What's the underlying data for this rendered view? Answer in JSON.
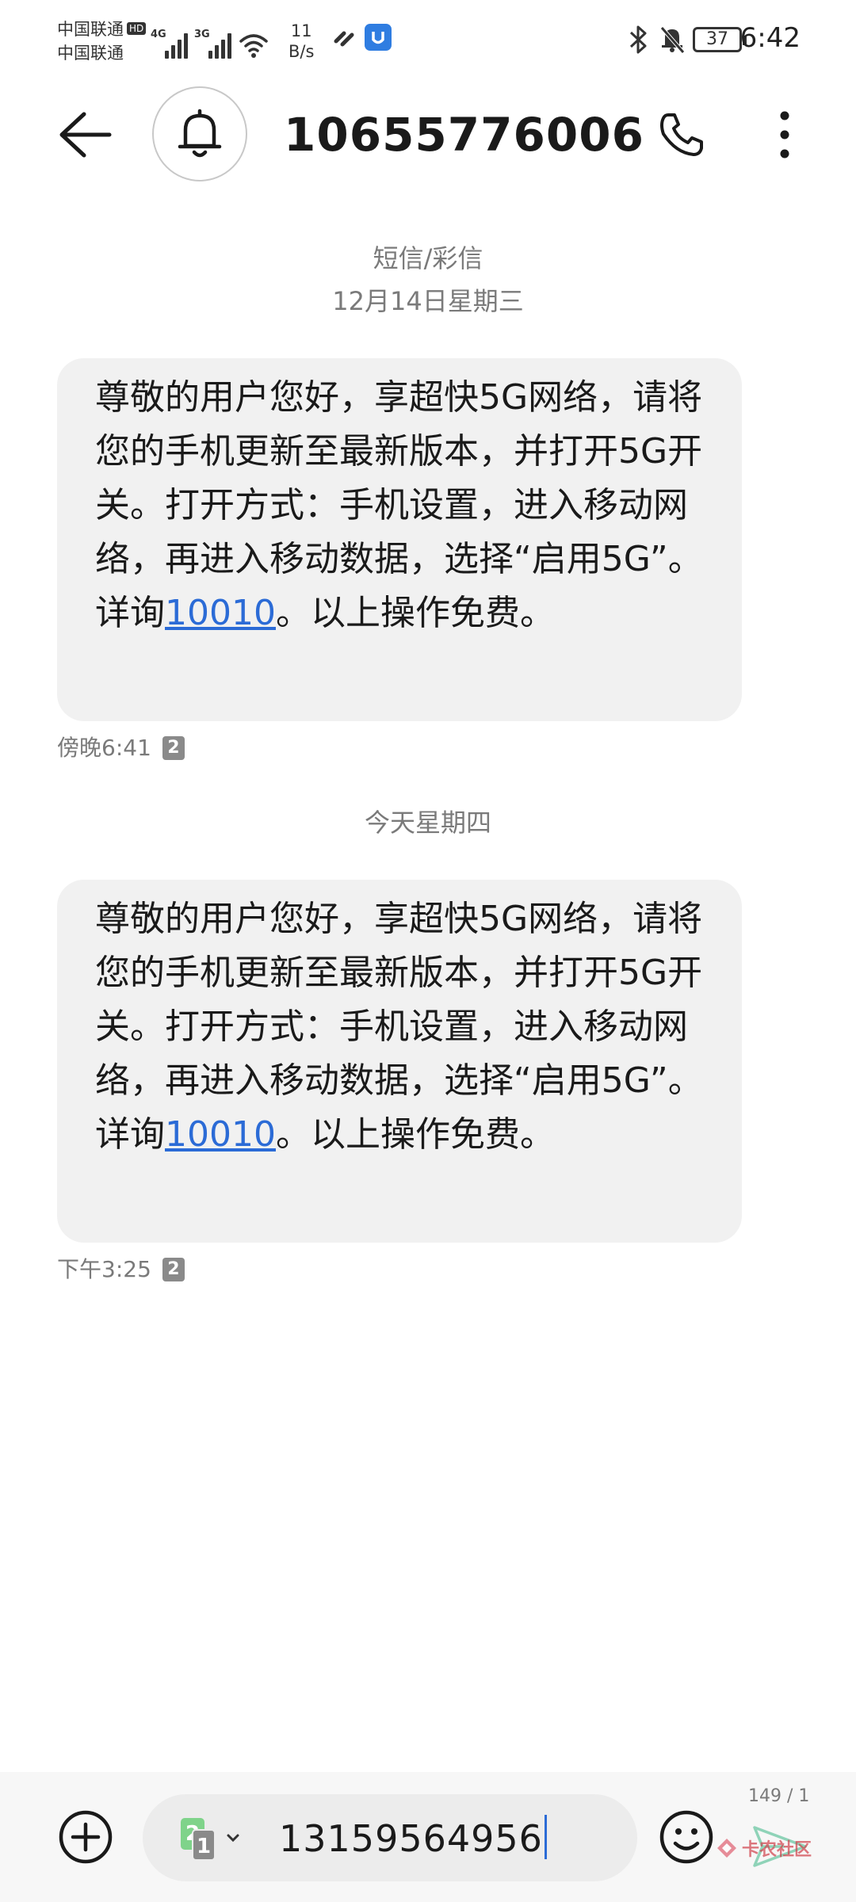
{
  "status_bar": {
    "carrier_1": "中国联通",
    "carrier_1_badge": "HD",
    "carrier_2": "中国联通",
    "signal_1_label": "4G",
    "signal_2_label": "3G",
    "net_speed_value": "11",
    "net_speed_unit": "B/s",
    "battery": "37",
    "time": "6:42"
  },
  "header": {
    "title": "10655776006"
  },
  "conversation": {
    "sep_1_type": "短信/彩信",
    "sep_1_date": "12月14日星期三",
    "msg_1": {
      "text_before": "尊敬的用户您好，享超快5G网络，请将您的手机更新至最新版本，并打开5G开关。打开方式：手机设置，进入移动网络，再进入移动数据，选择“启用5G”。详询",
      "link": "10010",
      "text_after": "。以上操作免费。",
      "time": "傍晚6:41",
      "sim": "2"
    },
    "sep_2_date": "今天星期四",
    "msg_2": {
      "text_before": "尊敬的用户您好，享超快5G网络，请将您的手机更新至最新版本，并打开5G开关。打开方式：手机设置，进入移动网络，再进入移动数据，选择“启用5G”。详询",
      "link": "10010",
      "text_after": "。以上操作免费。",
      "time": "下午3:25",
      "sim": "2"
    }
  },
  "composer": {
    "sim_front": "2",
    "sim_back": "1",
    "input_value": "13159564956",
    "char_count": "149 / 1",
    "watermark": "卡农社区"
  },
  "colors": {
    "link": "#2b6bd6",
    "bubble_bg": "#f1f1f1",
    "sim_active": "#7fd38a"
  },
  "icons": [
    "back-arrow-icon",
    "bell-icon",
    "phone-icon",
    "more-vertical-icon",
    "add-circle-icon",
    "emoji-icon",
    "send-icon",
    "bluetooth-icon",
    "mute-bell-icon",
    "wifi-icon"
  ]
}
